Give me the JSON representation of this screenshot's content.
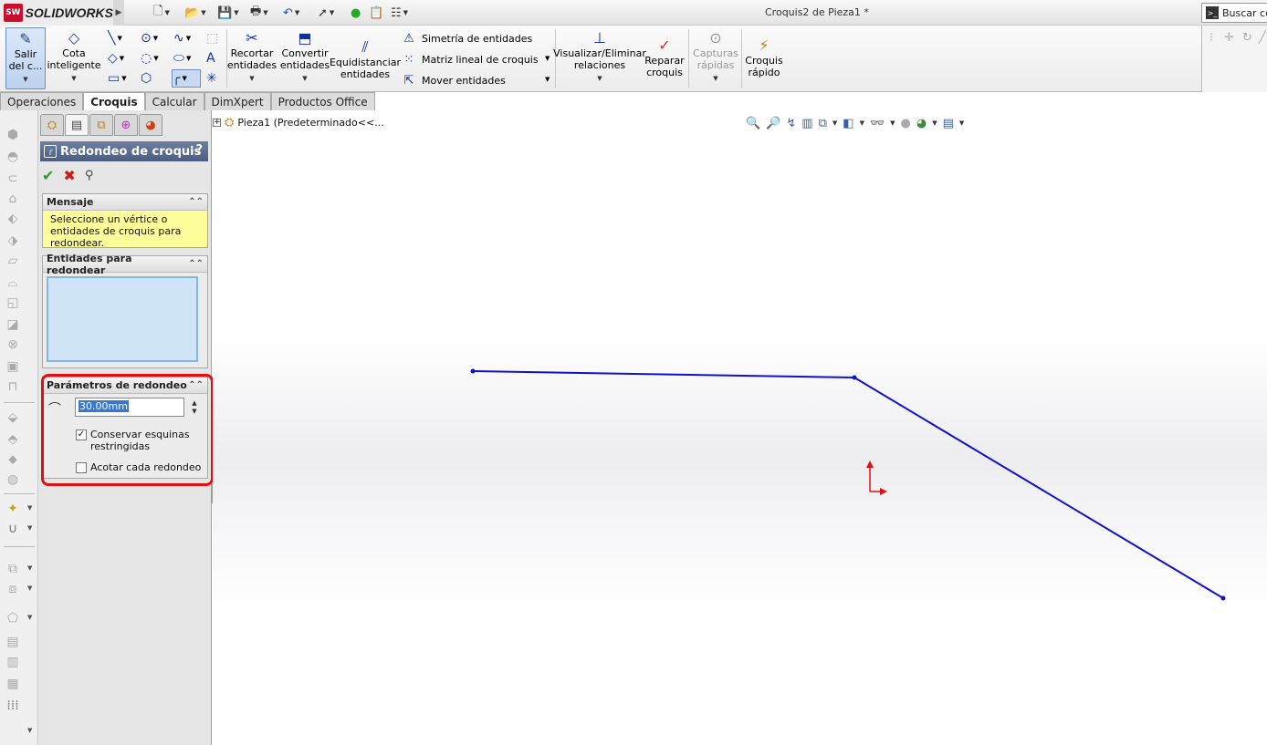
{
  "app": {
    "logo_badge": "SW",
    "logo_text": "SOLIDWORKS",
    "document_title": "Croquis2 de Pieza1 *",
    "search_label": "Buscar co"
  },
  "quick_access": [
    "new-icon",
    "open-icon",
    "save-icon",
    "print-icon",
    "undo-icon",
    "select-icon",
    "rebuild-icon",
    "file-properties-icon",
    "options-icon"
  ],
  "command_manager": {
    "exit_sketch": "Salir del c...",
    "smart_dimension": "Cota inteligente",
    "trim": "Recortar entidades",
    "convert": "Convertir entidades",
    "offset": "Equidistanciar entidades",
    "mirror": "Simetría de entidades",
    "linear_pattern": "Matriz lineal de croquis",
    "move": "Mover entidades",
    "relations": "Visualizar/Eliminar relaciones",
    "repair": "Reparar croquis",
    "snaps": "Capturas rápidas",
    "rapid_sketch": "Croquis rápido"
  },
  "tabs": [
    {
      "label": "Operaciones",
      "active": false
    },
    {
      "label": "Croquis",
      "active": true
    },
    {
      "label": "Calcular",
      "active": false
    },
    {
      "label": "DimXpert",
      "active": false
    },
    {
      "label": "Productos Office",
      "active": false
    }
  ],
  "property_manager": {
    "title": "Redondeo de croquis",
    "help": "?",
    "message_group": {
      "title": "Mensaje",
      "text": "Seleccione un vértice o entidades de croquis para redondear."
    },
    "entities_group": {
      "title": "Entidades para redondear"
    },
    "params_group": {
      "title": "Parámetros de redondeo",
      "radius_value": "30.00mm",
      "keep_corners_label": "Conservar esquinas restringidas",
      "keep_corners_checked": true,
      "dimension_each_label": "Acotar cada redondeo",
      "dimension_each_checked": false
    }
  },
  "feature_tree": {
    "root": "Pieza1  (Predeterminado<<..."
  },
  "colors": {
    "sketch_line": "#1010d0",
    "origin": "#e01010",
    "highlight": "#e01010",
    "message_bg": "#fdfd9a"
  }
}
